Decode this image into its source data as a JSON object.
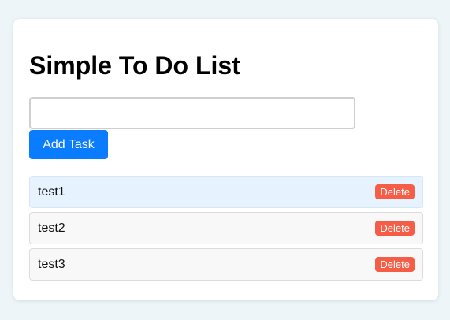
{
  "page": {
    "title": "Simple To Do List"
  },
  "form": {
    "input_value": "",
    "input_placeholder": "",
    "add_button_label": "Add Task"
  },
  "tasks": [
    {
      "text": "test1",
      "delete_label": "Delete",
      "highlighted": true
    },
    {
      "text": "test2",
      "delete_label": "Delete",
      "highlighted": false
    },
    {
      "text": "test3",
      "delete_label": "Delete",
      "highlighted": false
    }
  ],
  "colors": {
    "background": "#eef5f8",
    "card": "#ffffff",
    "accent": "#0a7cff",
    "danger": "#f65d47",
    "highlight_row": "#e6f3ff",
    "row": "#f8f8f8"
  }
}
